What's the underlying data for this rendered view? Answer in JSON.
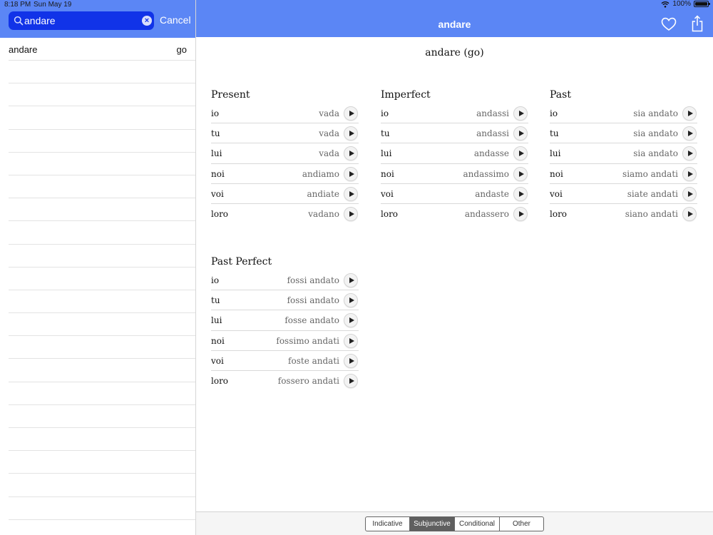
{
  "status_bar": {
    "time": "8:18 PM",
    "date": "Sun May 19",
    "battery": "100%",
    "battery_level": 1.0
  },
  "sidebar": {
    "search": {
      "value": "andare",
      "placeholder": ""
    },
    "cancel_label": "Cancel",
    "results": [
      {
        "word": "andare",
        "translation": "go"
      }
    ]
  },
  "main": {
    "title": "andare",
    "verb_heading": "andare (go)",
    "tenses": [
      {
        "name": "Present",
        "rows": [
          {
            "pronoun": "io",
            "form": "vada"
          },
          {
            "pronoun": "tu",
            "form": "vada"
          },
          {
            "pronoun": "lui",
            "form": "vada"
          },
          {
            "pronoun": "noi",
            "form": "andiamo"
          },
          {
            "pronoun": "voi",
            "form": "andiate"
          },
          {
            "pronoun": "loro",
            "form": "vadano"
          }
        ]
      },
      {
        "name": "Imperfect",
        "rows": [
          {
            "pronoun": "io",
            "form": "andassi"
          },
          {
            "pronoun": "tu",
            "form": "andassi"
          },
          {
            "pronoun": "lui",
            "form": "andasse"
          },
          {
            "pronoun": "noi",
            "form": "andassimo"
          },
          {
            "pronoun": "voi",
            "form": "andaste"
          },
          {
            "pronoun": "loro",
            "form": "andassero"
          }
        ]
      },
      {
        "name": "Past",
        "rows": [
          {
            "pronoun": "io",
            "form": "sia andato"
          },
          {
            "pronoun": "tu",
            "form": "sia andato"
          },
          {
            "pronoun": "lui",
            "form": "sia andato"
          },
          {
            "pronoun": "noi",
            "form": "siamo andati"
          },
          {
            "pronoun": "voi",
            "form": "siate andati"
          },
          {
            "pronoun": "loro",
            "form": "siano andati"
          }
        ]
      },
      {
        "name": "Past Perfect",
        "rows": [
          {
            "pronoun": "io",
            "form": "fossi andato"
          },
          {
            "pronoun": "tu",
            "form": "fossi andato"
          },
          {
            "pronoun": "lui",
            "form": "fosse andato"
          },
          {
            "pronoun": "noi",
            "form": "fossimo andati"
          },
          {
            "pronoun": "voi",
            "form": "foste andati"
          },
          {
            "pronoun": "loro",
            "form": "fossero andati"
          }
        ]
      }
    ]
  },
  "mood_tabs": {
    "selected": "Subjunctive",
    "items": [
      "Indicative",
      "Subjunctive",
      "Conditional",
      "Other"
    ]
  },
  "icons": {
    "search": "search-icon",
    "clear": "clear-search-icon",
    "favorite": "heart-icon",
    "share": "share-icon",
    "play": "play-icon",
    "wifi": "wifi-icon",
    "battery": "battery-icon"
  },
  "colors": {
    "header_blue": "#5b86f5",
    "search_field": "#1133e8",
    "segment_active": "#5f5f5f"
  }
}
